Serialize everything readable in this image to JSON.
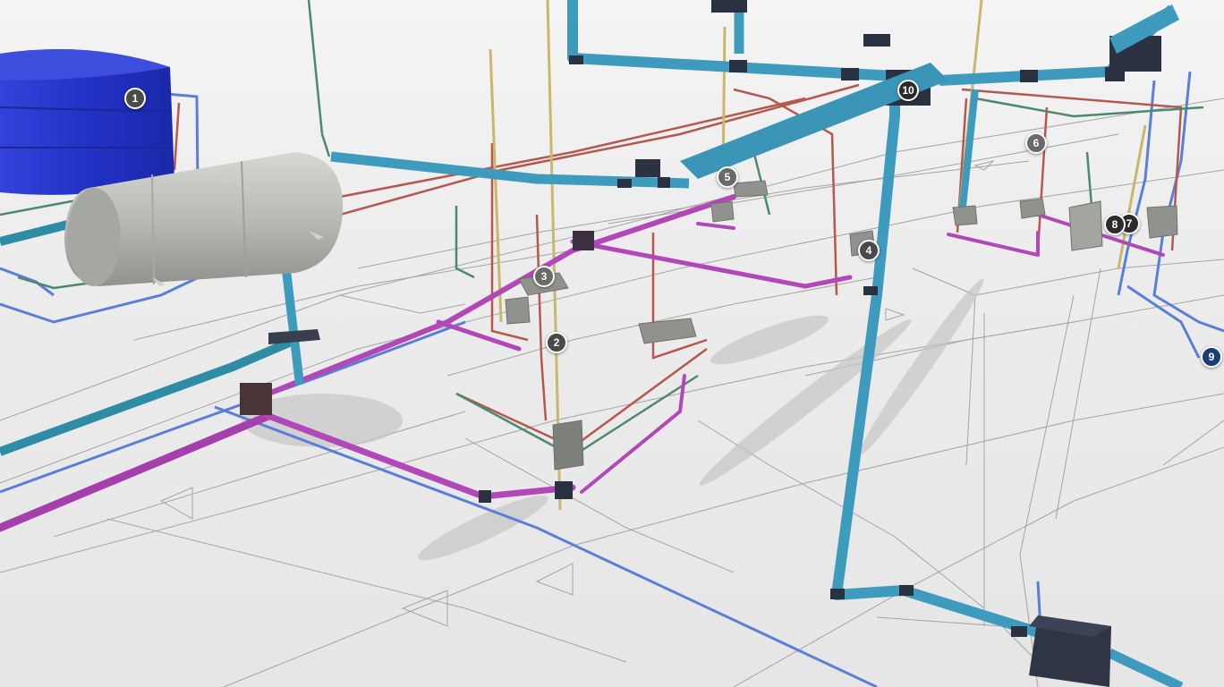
{
  "viewer": {
    "background": "#ececec",
    "colors": {
      "storm_drain": "#3f9bbd",
      "sewer": "#b247b8",
      "cold_water": "#5b7fd6",
      "hot_water": "#b5584e",
      "vent": "#4b8a6c",
      "gas": "#c9b86a",
      "floorplan_lines": "#9a9a9a",
      "tank": "#2432c9",
      "boiler": "#b9bcb8",
      "box": "#32384a"
    }
  },
  "hotspots": [
    {
      "id": "hotspot-1",
      "label": "1",
      "color": "#4a4a4a"
    },
    {
      "id": "hotspot-2",
      "label": "2",
      "color": "#4a4a4a"
    },
    {
      "id": "hotspot-3",
      "label": "3",
      "color": "#6a6a6a"
    },
    {
      "id": "hotspot-4",
      "label": "4",
      "color": "#4a4a4a"
    },
    {
      "id": "hotspot-5",
      "label": "5",
      "color": "#6a6a6a"
    },
    {
      "id": "hotspot-6",
      "label": "6",
      "color": "#6a6a6a"
    },
    {
      "id": "hotspot-7",
      "label": "7",
      "color": "#2b2b2b"
    },
    {
      "id": "hotspot-8",
      "label": "8",
      "color": "#2b2b2b"
    },
    {
      "id": "hotspot-9",
      "label": "9",
      "color": "#1d3d78"
    },
    {
      "id": "hotspot-10",
      "label": "10",
      "color": "#2b2b2b"
    }
  ]
}
